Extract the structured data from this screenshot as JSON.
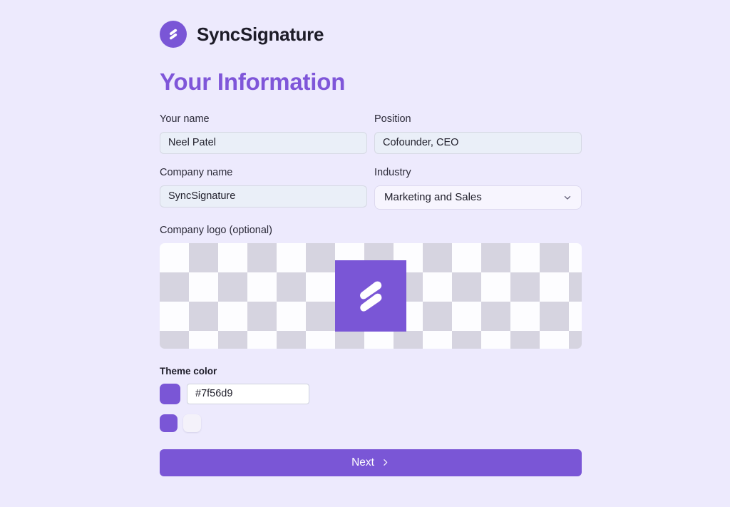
{
  "brand": {
    "name": "SyncSignature",
    "logo_icon": "syncsignature-bolt-logo",
    "logo_color": "#7a56d6"
  },
  "header": {
    "title": "Your Information",
    "title_color": "#7f56d9"
  },
  "form": {
    "fields": [
      {
        "key": "your_name",
        "label": "Your name",
        "value": "Neel Patel",
        "placeholder": "Your name",
        "type": "text"
      },
      {
        "key": "position",
        "label": "Position",
        "value": "Cofounder, CEO",
        "placeholder": "Position",
        "type": "text"
      },
      {
        "key": "company_name",
        "label": "Company name",
        "value": "SyncSignature",
        "placeholder": "Company name",
        "type": "text"
      },
      {
        "key": "industry",
        "label": "Industry",
        "value": "Marketing and Sales",
        "type": "select",
        "chevron_icon": "chevron-down-icon"
      }
    ]
  },
  "logo_upload": {
    "label": "Company logo (optional)",
    "image_alt": "SyncSignature logo",
    "image_bg_color": "#7a56d6",
    "checker_light": "#fdfdff",
    "checker_dark": "#d6d4e0"
  },
  "theme_color": {
    "label": "Theme color",
    "hex_value": "#7f56d9",
    "hex_placeholder": "#7f56d9",
    "current_swatch_color": "#7a56d6",
    "presets": [
      {
        "name": "purple",
        "color": "#7a56d6"
      },
      {
        "name": "white",
        "color": "#f4f2fa"
      }
    ]
  },
  "footer": {
    "next_label": "Next",
    "next_icon": "chevron-right-icon"
  },
  "page": {
    "background_color": "#edeafd"
  }
}
